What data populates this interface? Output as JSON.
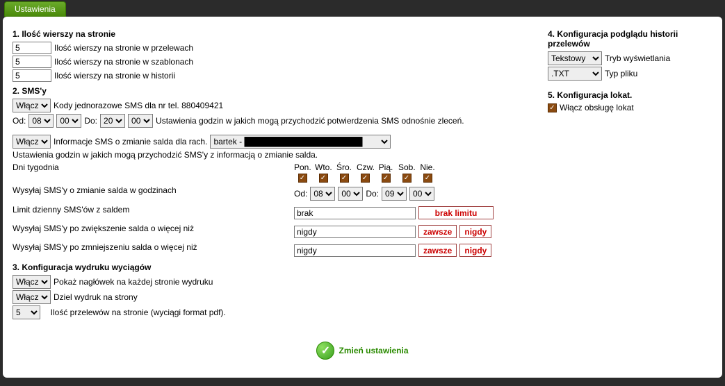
{
  "tab": "Ustawienia",
  "s1": {
    "title": "1. Ilość wierszy na stronie",
    "v1": "5",
    "l1": "Ilość wierszy na stronie w przelewach",
    "v2": "5",
    "l2": "Ilość wierszy na stronie w szablonach",
    "v3": "5",
    "l3": "Ilość wierszy na stronie w historii"
  },
  "s2": {
    "title": "2. SMS'y",
    "enable": "Włącz",
    "enable_label": "Kody jednorazowe SMS dla nr tel. 880409421",
    "od": "Od:",
    "do": "Do:",
    "from_h": "08",
    "from_m": "00",
    "to_h": "20",
    "to_m": "00",
    "hours_label": "Ustawienia godzin w jakich mogą przychodzić potwierdzenia SMS odnośnie zleceń.",
    "saldo_enable": "Włącz",
    "saldo_label": "Informacje SMS o zmianie salda dla rach.",
    "account": "bartek - ",
    "saldo_hours_label": "Ustawienia godzin w jakich mogą przychodzić SMS'y z informacją o zmianie salda.",
    "days_label": "Dni tygodnia",
    "days": [
      "Pon.",
      "Wto.",
      "Śro.",
      "Czw.",
      "Pią.",
      "Sob.",
      "Nie."
    ],
    "hours2_label": "Wysyłaj SMS'y o zmianie salda w godzinach",
    "h2_from_h": "08",
    "h2_from_m": "00",
    "h2_to_h": "09",
    "h2_to_m": "00",
    "limit_label": "Limit dzienny SMS'ów z saldem",
    "limit_val": "brak",
    "limit_btn": "brak limitu",
    "inc_label": "Wysyłaj SMS'y po zwiększenie salda o więcej niż",
    "inc_val": "nigdy",
    "dec_label": "Wysyłaj SMS'y po zmniejszeniu salda o więcej niż",
    "dec_val": "nigdy",
    "zawsze": "zawsze",
    "nigdy": "nigdy"
  },
  "s3": {
    "title": "3. Konfiguracja wydruku wyciągów",
    "header_sel": "Włącz",
    "header_label": "Pokaż nagłówek na każdej stronie wydruku",
    "split_sel": "Włącz",
    "split_label": "Dziel wydruk na strony",
    "count": "5",
    "count_label": "Ilość przelewów na stronie (wyciągi format pdf)."
  },
  "s4": {
    "title": "4. Konfiguracja podglądu historii przelewów",
    "mode": "Tekstowy",
    "mode_label": "Tryb wyświetlania",
    "ftype": ".TXT",
    "ftype_label": "Typ pliku"
  },
  "s5": {
    "title": "5. Konfiguracja lokat.",
    "chk_label": "Włącz obsługę lokat"
  },
  "submit": "Zmień ustawienia"
}
